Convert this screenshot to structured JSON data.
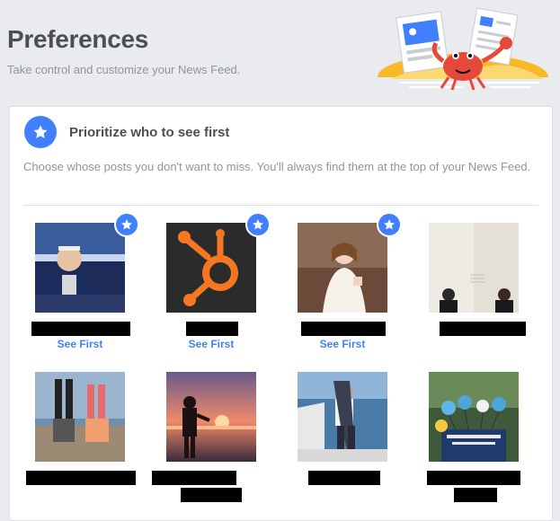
{
  "header": {
    "title": "Preferences",
    "subtitle": "Take control and customize your News Feed."
  },
  "section": {
    "icon": "star-icon",
    "title": "Prioritize who to see first",
    "description": "Choose whose posts you don't want to miss. You'll always find them at the top of your News Feed."
  },
  "colors": {
    "accent": "#4080ff",
    "background": "#e9ebee",
    "title_text": "#4b4f56",
    "secondary_text": "#90949c"
  },
  "people": [
    {
      "photo": "man-in-patriots-jersey-at-stadium",
      "name_redacted": true,
      "see_first": true,
      "see_first_label": "See First"
    },
    {
      "photo": "hubspot-orange-sprocket-logo",
      "name_redacted": true,
      "see_first": true,
      "see_first_label": "See First"
    },
    {
      "photo": "woman-in-wedding-dress",
      "name_redacted": true,
      "see_first": true,
      "see_first_label": "See First"
    },
    {
      "photo": "two-people-against-white-wall",
      "name_redacted": true,
      "see_first": false
    },
    {
      "photo": "two-people-doing-handstands",
      "name_redacted": true,
      "see_first": false
    },
    {
      "photo": "silhouette-at-sunset-beach",
      "name_redacted": true,
      "see_first": false
    },
    {
      "photo": "man-holding-fish-on-boat",
      "name_redacted": true,
      "see_first": false
    },
    {
      "photo": "balloons-at-event-table",
      "name_redacted": true,
      "see_first": false
    }
  ]
}
